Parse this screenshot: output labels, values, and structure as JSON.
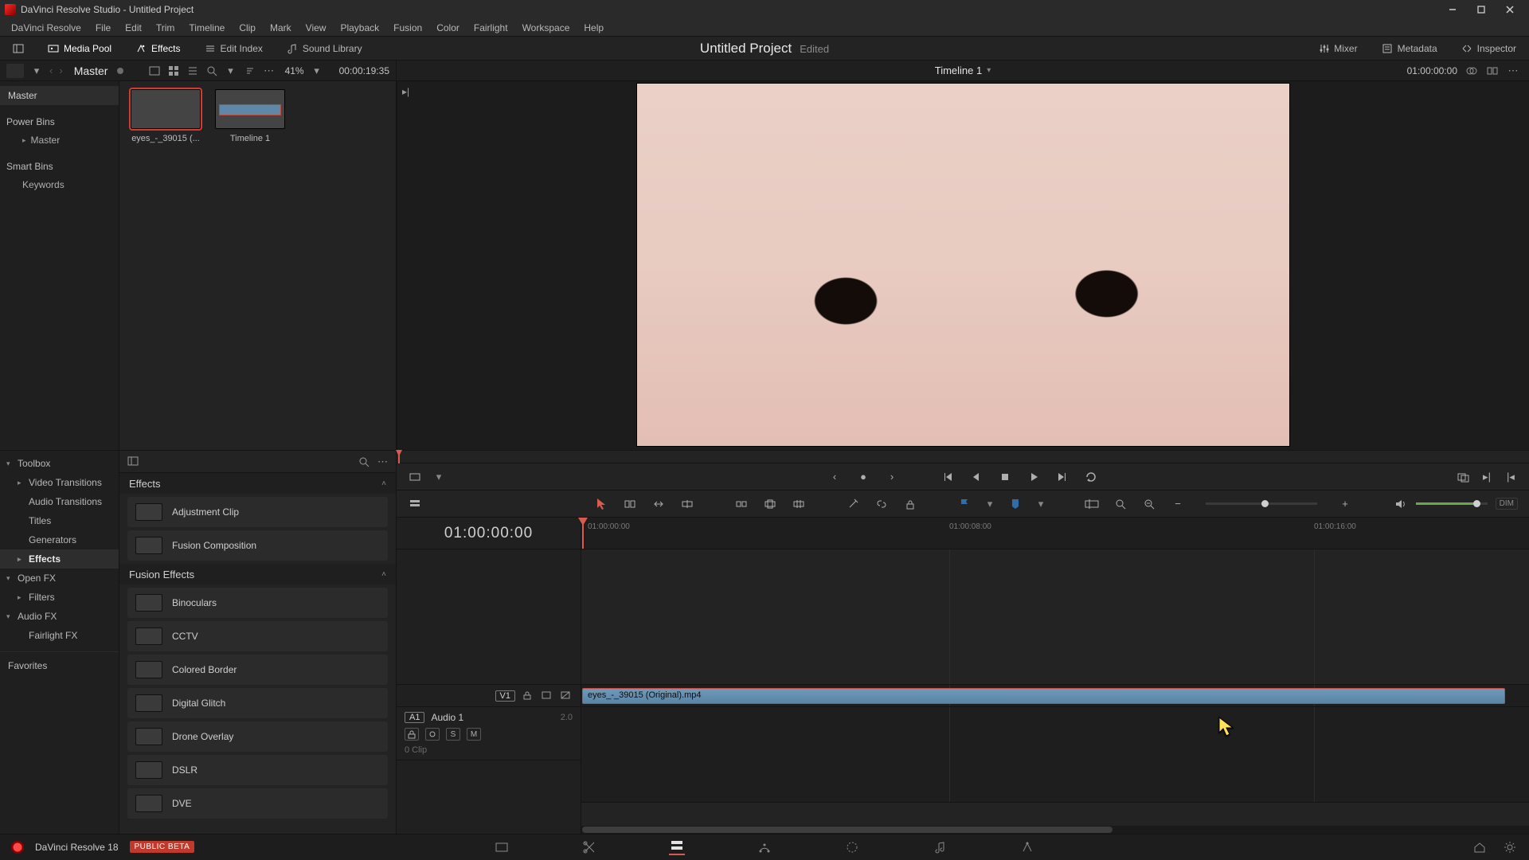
{
  "window": {
    "title": "DaVinci Resolve Studio - Untitled Project"
  },
  "menu": [
    "DaVinci Resolve",
    "File",
    "Edit",
    "Trim",
    "Timeline",
    "Clip",
    "Mark",
    "View",
    "Playback",
    "Fusion",
    "Color",
    "Fairlight",
    "Workspace",
    "Help"
  ],
  "topbar": {
    "media_pool": "Media Pool",
    "effects": "Effects",
    "edit_index": "Edit Index",
    "sound_library": "Sound Library",
    "project": "Untitled Project",
    "status": "Edited",
    "mixer": "Mixer",
    "metadata": "Metadata",
    "inspector": "Inspector"
  },
  "mp_head": {
    "crumb": "Master",
    "zoom": "41%",
    "tc": "00:00:19:35"
  },
  "viewer_head": {
    "timeline_name": "Timeline 1",
    "tc_right": "01:00:00:00"
  },
  "tree": {
    "root": "Master",
    "power_bins": "Power Bins",
    "power_master": "Master",
    "smart_bins": "Smart Bins",
    "keywords": "Keywords"
  },
  "clips": [
    {
      "label": "eyes_-_39015 (..."
    },
    {
      "label": "Timeline 1"
    }
  ],
  "fx_tree": {
    "toolbox": "Toolbox",
    "vtrans": "Video Transitions",
    "atrans": "Audio Transitions",
    "titles": "Titles",
    "generators": "Generators",
    "effects": "Effects",
    "openfx": "Open FX",
    "filters": "Filters",
    "audiofx": "Audio FX",
    "fairlight": "Fairlight FX",
    "favorites": "Favorites"
  },
  "fx_groups": {
    "effects_head": "Effects",
    "fusion_head": "Fusion Effects"
  },
  "fx_items": {
    "adj": "Adjustment Clip",
    "fcomp": "Fusion Composition",
    "bino": "Binoculars",
    "cctv": "CCTV",
    "cborder": "Colored Border",
    "dglitch": "Digital Glitch",
    "drone": "Drone Overlay",
    "dslr": "DSLR",
    "dve": "DVE"
  },
  "timeline": {
    "big_tc": "01:00:00:00",
    "ruler": {
      "t0": "01:00:00:00",
      "t1": "01:00:08:00",
      "t2": "01:00:16:00"
    },
    "v1": "V1",
    "a1": "A1",
    "a1_name": "Audio 1",
    "a1_ch": "2.0",
    "a1_clips": "0 Clip",
    "s": "S",
    "m": "M",
    "clip_name": "eyes_-_39015 (Original).mp4",
    "dim": "DIM"
  },
  "pagebar": {
    "brand": "DaVinci Resolve 18",
    "beta": "PUBLIC BETA"
  }
}
